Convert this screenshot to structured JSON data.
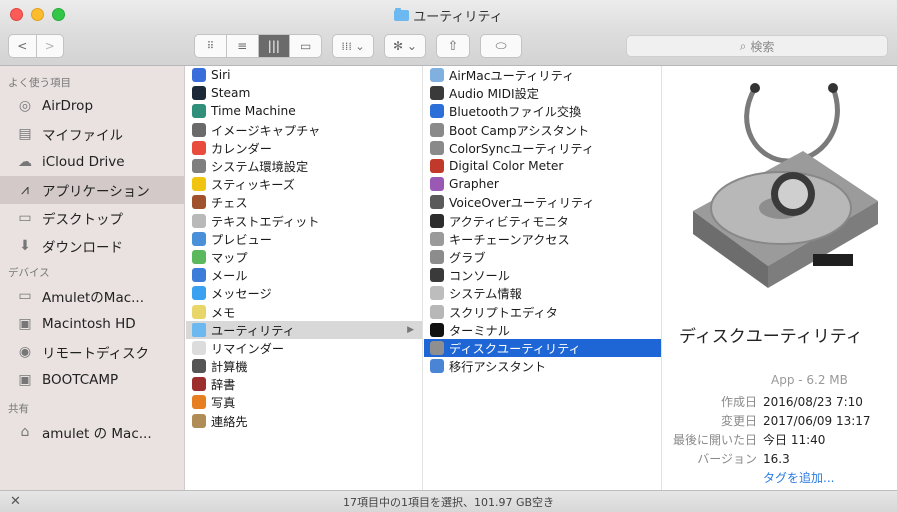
{
  "window": {
    "title": "ユーティリティ"
  },
  "toolbar": {
    "back": "<",
    "forward": ">",
    "view_icon": "▯▯▯",
    "view_columns": "|||",
    "view_cover": "▭",
    "arrange_icon": "⁞⁞⁞ ⌄",
    "action_icon": "✻ ⌄",
    "share_icon": "⇧",
    "tag_icon": "⬭",
    "search_placeholder": "検索"
  },
  "sidebar": {
    "favorites_header": "よく使う項目",
    "favorites": [
      {
        "label": "AirDrop",
        "icon": "airdrop-icon",
        "glyph": "◎"
      },
      {
        "label": "マイファイル",
        "icon": "myfiles-icon",
        "glyph": "▤"
      },
      {
        "label": "iCloud Drive",
        "icon": "cloud-icon",
        "glyph": "☁"
      },
      {
        "label": "アプリケーション",
        "icon": "applications-icon",
        "glyph": "⩘",
        "active": true
      },
      {
        "label": "デスクトップ",
        "icon": "desktop-icon",
        "glyph": "▭"
      },
      {
        "label": "ダウンロード",
        "icon": "download-icon",
        "glyph": "⬇"
      }
    ],
    "devices_header": "デバイス",
    "devices": [
      {
        "label": "AmuletのMac...",
        "icon": "laptop-icon",
        "glyph": "▭"
      },
      {
        "label": "Macintosh HD",
        "icon": "disk-icon",
        "glyph": "▣"
      },
      {
        "label": "リモートディスク",
        "icon": "remote-disc-icon",
        "glyph": "◉"
      },
      {
        "label": "BOOTCAMP",
        "icon": "disk-icon",
        "glyph": "▣"
      }
    ],
    "shared_header": "共有",
    "shared": [
      {
        "label": "amulet の Mac...",
        "icon": "shared-computer-icon",
        "glyph": "⌂"
      }
    ]
  },
  "column1": [
    {
      "label": "Siri",
      "color": "#3a6ddc"
    },
    {
      "label": "Steam",
      "color": "#1b2838"
    },
    {
      "label": "Time Machine",
      "color": "#2f8f7a"
    },
    {
      "label": "イメージキャプチャ",
      "color": "#6a6a6a"
    },
    {
      "label": "カレンダー",
      "color": "#e74c3c"
    },
    {
      "label": "システム環境設定",
      "color": "#7f7f7f"
    },
    {
      "label": "スティッキーズ",
      "color": "#f1c40f"
    },
    {
      "label": "チェス",
      "color": "#a0522d"
    },
    {
      "label": "テキストエディット",
      "color": "#b9b9b9"
    },
    {
      "label": "プレビュー",
      "color": "#4a90d9"
    },
    {
      "label": "マップ",
      "color": "#5cb85c"
    },
    {
      "label": "メール",
      "color": "#3b7dd8"
    },
    {
      "label": "メッセージ",
      "color": "#3aa0f0"
    },
    {
      "label": "メモ",
      "color": "#e9d66b"
    },
    {
      "label": "ユーティリティ",
      "color": "#6cb8f0",
      "selected": true,
      "folder": true
    },
    {
      "label": "リマインダー",
      "color": "#dcdcdc"
    },
    {
      "label": "計算機",
      "color": "#555555"
    },
    {
      "label": "辞書",
      "color": "#9b2d2d"
    },
    {
      "label": "写真",
      "color": "#e67e22"
    },
    {
      "label": "連絡先",
      "color": "#b08d57"
    }
  ],
  "column2": [
    {
      "label": "AirMacユーティリティ",
      "color": "#7fb0e0"
    },
    {
      "label": "Audio MIDI設定",
      "color": "#3a3a3a"
    },
    {
      "label": "Bluetoothファイル交換",
      "color": "#2d6fd8"
    },
    {
      "label": "Boot Campアシスタント",
      "color": "#8a8a8a"
    },
    {
      "label": "ColorSyncユーティリティ",
      "color": "#8a8a8a"
    },
    {
      "label": "Digital Color Meter",
      "color": "#c0392b"
    },
    {
      "label": "Grapher",
      "color": "#9b59b6"
    },
    {
      "label": "VoiceOverユーティリティ",
      "color": "#5a5a5a"
    },
    {
      "label": "アクティビティモニタ",
      "color": "#2d2d2d"
    },
    {
      "label": "キーチェーンアクセス",
      "color": "#9a9a9a"
    },
    {
      "label": "グラブ",
      "color": "#8c8c8c"
    },
    {
      "label": "コンソール",
      "color": "#3a3a3a"
    },
    {
      "label": "システム情報",
      "color": "#bdbdbd"
    },
    {
      "label": "スクリプトエディタ",
      "color": "#b7b7b7"
    },
    {
      "label": "ターミナル",
      "color": "#111111"
    },
    {
      "label": "ディスクユーティリティ",
      "color": "#8f8f8f",
      "selected": true
    },
    {
      "label": "移行アシスタント",
      "color": "#4a84d4"
    }
  ],
  "preview": {
    "name": "ディスクユーティリティ",
    "kind": "App - 6.2 MB",
    "meta": [
      {
        "key": "作成日",
        "value": "2016/08/23 7:10"
      },
      {
        "key": "変更日",
        "value": "2017/06/09 13:17"
      },
      {
        "key": "最後に開いた日",
        "value": "今日 11:40"
      },
      {
        "key": "バージョン",
        "value": "16.3"
      }
    ],
    "add_tags": "タグを追加..."
  },
  "status": {
    "text": "17項目中の1項目を選択、101.97 GB空き"
  }
}
